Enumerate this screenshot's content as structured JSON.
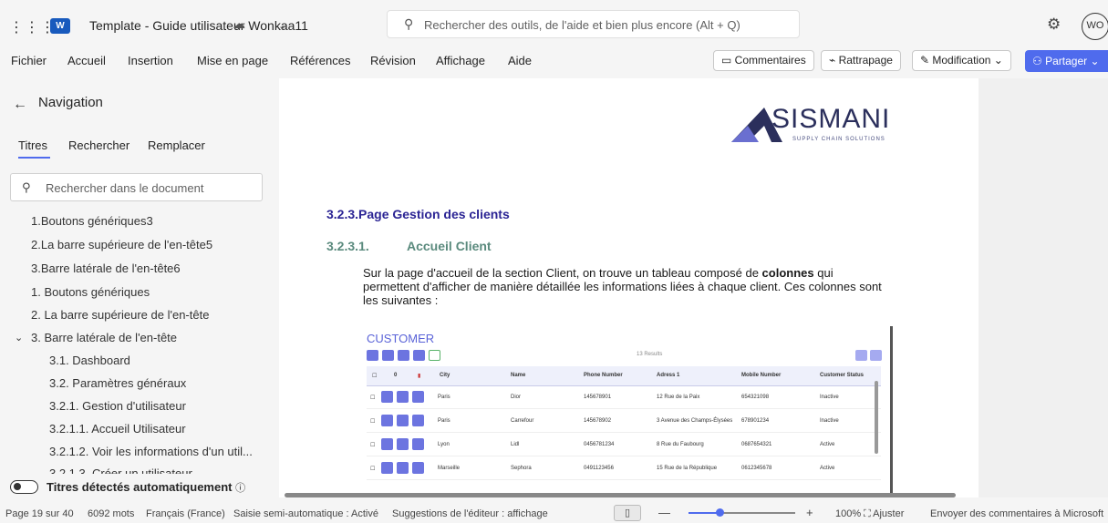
{
  "titlebar": {
    "app_icon": "W",
    "doc_title": "Template - Guide utilisateur Wonkaa11",
    "search_placeholder": "Rechercher des outils, de l'aide et bien plus encore (Alt + Q)",
    "avatar_initials": "WO"
  },
  "menu": {
    "items": [
      "Fichier",
      "Accueil",
      "Insertion",
      "Mise en page",
      "Références",
      "Révision",
      "Affichage",
      "Aide"
    ],
    "comments": "Commentaires",
    "catchup": "Rattrapage",
    "editing": "Modification",
    "share": "Partager"
  },
  "nav": {
    "title": "Navigation",
    "tabs": [
      "Titres",
      "Rechercher",
      "Remplacer"
    ],
    "search_placeholder": "Rechercher dans le document",
    "items": [
      "1.Boutons génériques3",
      "2.La barre supérieure de l'en-tête5",
      "3.Barre latérale de l'en-tête6",
      "1. Boutons génériques",
      "2. La barre supérieure de l'en-tête",
      "3. Barre latérale de l'en-tête",
      "3.1. Dashboard",
      "3.2. Paramètres généraux",
      "3.2.1. Gestion d'utilisateur",
      "3.2.1.1. Accueil Utilisateur",
      "3.2.1.2. Voir les informations d'un util...",
      "3.2.1.3. Créer un utilisateur"
    ],
    "auto_headings": "Titres détectés automatiquement"
  },
  "document": {
    "logo_name": "SISMANI",
    "logo_tagline": "SUPPLY CHAIN SOLUTIONS",
    "heading3": "3.2.3.Page Gestion des clients",
    "heading4_num": "3.2.3.1.",
    "heading4_text": "Accueil Client",
    "para_part1": "Sur la page d'accueil de la section Client, on trouve un tableau composé de ",
    "para_bold": "colonnes",
    "para_part2": " qui permettent d'afficher de manière détaillée les informations liées à chaque client. Ces colonnes sont les suivantes :",
    "embed": {
      "title": "CUSTOMER",
      "results": "13 Results",
      "header": [
        "0",
        "City",
        "Name",
        "Phone Number",
        "Adress 1",
        "Mobile Number",
        "Customer Status"
      ],
      "rows": [
        [
          "Paris",
          "Dior",
          "145678901",
          "12 Rue de la Paix",
          "654321098",
          "Inactive"
        ],
        [
          "Paris",
          "Carrefour",
          "145678902",
          "3 Avenue des Champs-Élysées",
          "678901234",
          "Inactive"
        ],
        [
          "Lyon",
          "Lidl",
          "0456781234",
          "8 Rue du Faubourg",
          "0687654321",
          "Active"
        ],
        [
          "Marseille",
          "Sephora",
          "0491123456",
          "15 Rue de la République",
          "0612345678",
          "Active"
        ]
      ]
    }
  },
  "status": {
    "page": "Page 19 sur 40",
    "words": "6092 mots",
    "language": "Français (France)",
    "input": "Saisie semi-automatique : Activé",
    "suggestions": "Suggestions de l'éditeur : affichage",
    "zoom_minus": "—",
    "zoom_plus": "+",
    "zoom": "100%",
    "fit": "Ajuster",
    "feedback": "Envoyer des commentaires à Microsoft"
  },
  "colors": {
    "accent": "#4f6bed",
    "heading3": "#2b2494",
    "heading4": "#5a8a7d",
    "embed_accent": "#6c74e0"
  }
}
